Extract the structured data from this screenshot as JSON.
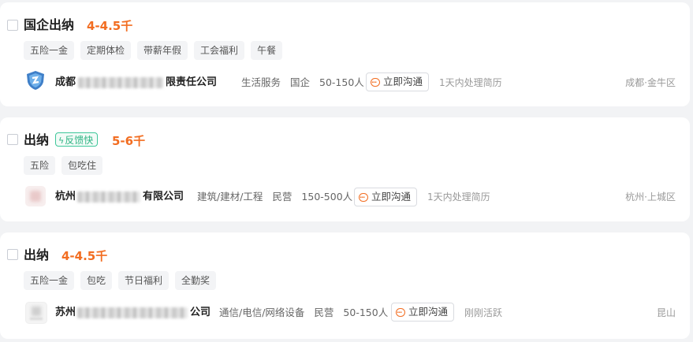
{
  "jobs": [
    {
      "title": "国企出纳",
      "badge": "",
      "salary": "4-4.5千",
      "tags": [
        "五险一金",
        "定期体检",
        "带薪年假",
        "工会福利",
        "午餐"
      ],
      "company_prefix": "成都",
      "company_suffix": "限责任公司",
      "industry": "生活服务",
      "stage": "国企",
      "size": "50-150人",
      "chat_label": "立即沟通",
      "activity": "1天内处理简历",
      "location": "成都·金牛区",
      "logo_icon": "shield-logo-icon"
    },
    {
      "title": "出纳",
      "badge": "反馈快",
      "salary": "5-6千",
      "tags": [
        "五险",
        "包吃住"
      ],
      "company_prefix": "杭州",
      "company_suffix": "有限公司",
      "industry": "建筑/建材/工程",
      "stage": "民营",
      "size": "150-500人",
      "chat_label": "立即沟通",
      "activity": "1天内处理简历",
      "location": "杭州·上城区",
      "logo_icon": "blurred-logo-icon"
    },
    {
      "title": "出纳",
      "badge": "",
      "salary": "4-4.5千",
      "tags": [
        "五险一金",
        "包吃",
        "节日福利",
        "全勤奖"
      ],
      "company_prefix": "苏州",
      "company_suffix": "公司",
      "industry": "通信/电信/网络设备",
      "stage": "民营",
      "size": "50-150人",
      "chat_label": "立即沟通",
      "activity": "刚刚活跃",
      "location": "昆山",
      "logo_icon": "blurred-logo-icon"
    }
  ],
  "colors": {
    "salary": "#f26d21",
    "badge": "#2fb585",
    "page_bg": "#f2f3f5"
  }
}
